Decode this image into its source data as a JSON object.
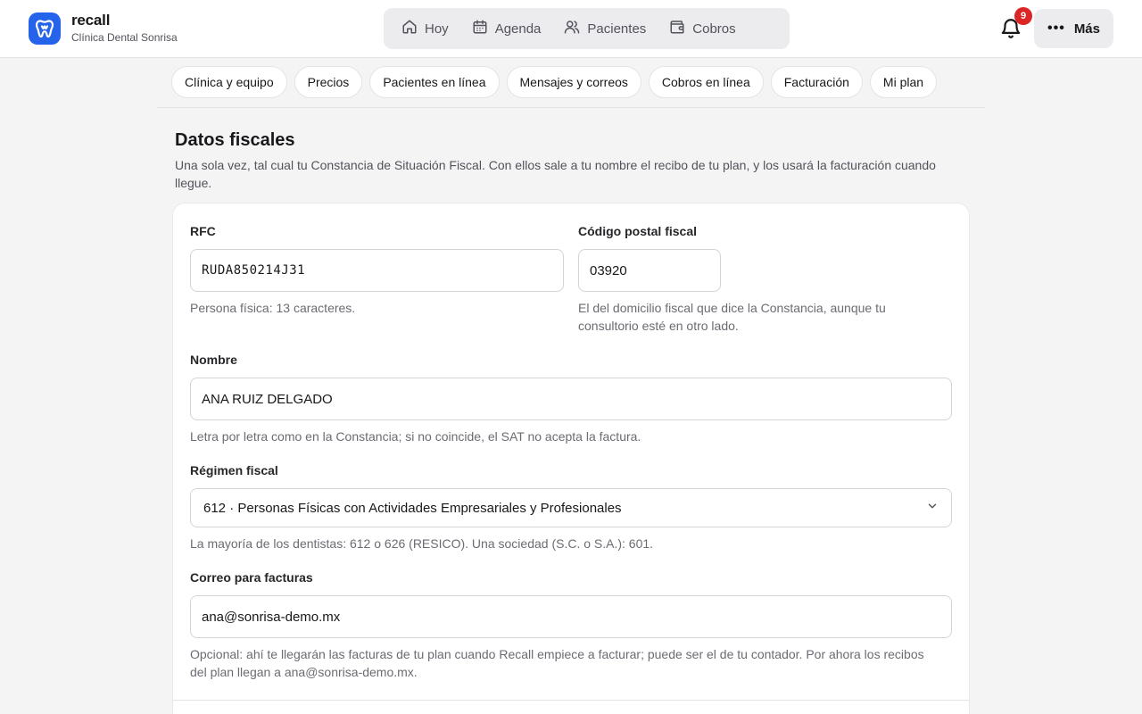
{
  "app": {
    "name": "recall",
    "clinic": "Clínica Dental Sonrisa"
  },
  "nav": {
    "items": [
      {
        "label": "Hoy",
        "icon": "home-icon"
      },
      {
        "label": "Agenda",
        "icon": "calendar-icon"
      },
      {
        "label": "Pacientes",
        "icon": "users-icon"
      },
      {
        "label": "Cobros",
        "icon": "wallet-icon"
      }
    ]
  },
  "notifications": {
    "count": "9"
  },
  "more": {
    "label": "Más"
  },
  "tabs": [
    "Clínica y equipo",
    "Precios",
    "Pacientes en línea",
    "Mensajes y correos",
    "Cobros en línea",
    "Facturación",
    "Mi plan"
  ],
  "section": {
    "title": "Datos fiscales",
    "description": "Una sola vez, tal cual tu Constancia de Situación Fiscal. Con ellos sale a tu nombre el recibo de tu plan, y los usará la facturación cuando llegue."
  },
  "form": {
    "rfc": {
      "label": "RFC",
      "value": "RUDA850214J31",
      "help": "Persona física: 13 caracteres."
    },
    "cp": {
      "label": "Código postal fiscal",
      "value": "03920",
      "help": "El del domicilio fiscal que dice la Constancia, aunque tu consultorio esté en otro lado."
    },
    "nombre": {
      "label": "Nombre",
      "value": "ANA RUIZ DELGADO",
      "help": "Letra por letra como en la Constancia; si no coincide, el SAT no acepta la factura."
    },
    "regimen": {
      "label": "Régimen fiscal",
      "value": "612 · Personas Físicas con Actividades Empresariales y Profesionales",
      "help": "La mayoría de los dentistas: 612 o 626 (RESICO). Una sociedad (S.C. o S.A.): 601."
    },
    "correo": {
      "label": "Correo para facturas",
      "value": "ana@sonrisa-demo.mx",
      "help": "Opcional: ahí te llegarán las facturas de tu plan cuando Recall empiece a facturar; puede ser el de tu contador. Por ahora los recibos del plan llegan a ana@sonrisa-demo.mx."
    }
  },
  "colors": {
    "brand": "#2563eb",
    "badge": "#dc2626",
    "background": "#f4f4f5"
  }
}
